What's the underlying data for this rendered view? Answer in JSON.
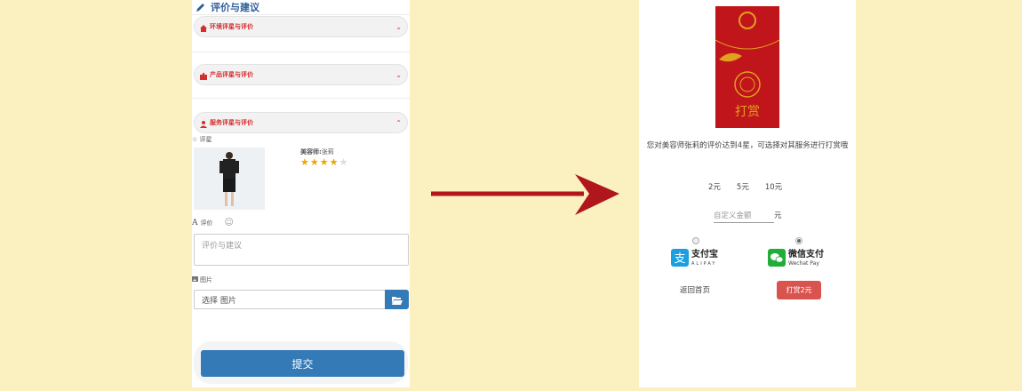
{
  "left": {
    "header_title": "评价与建议",
    "accordions": [
      {
        "label": "环境评星与评价",
        "icon": "home-icon"
      },
      {
        "label": "产品评星与评价",
        "icon": "briefcase-icon"
      },
      {
        "label": "服务评星与评价",
        "icon": "user-icon"
      }
    ],
    "rating_label": "☆ 评星",
    "beautician_prefix": "美容师:",
    "beautician_name": "张莉",
    "rating_stars": 4,
    "rating_max": 5,
    "comment_label": "评价",
    "comment_placeholder": "评价与建议",
    "image_label": "图片",
    "file_placeholder": "选择 图片",
    "submit_label": "提交",
    "colors": {
      "accent": "#337ab7",
      "red": "#d62d2d",
      "star": "#f0a500"
    }
  },
  "right": {
    "envelope_text": "打赏",
    "message": "您对美容师张莉的评价达到4星，可选择对其服务进行打赏哦",
    "amounts": [
      "2元",
      "5元",
      "10元"
    ],
    "custom_placeholder": "自定义金额",
    "unit": "元",
    "payments": [
      {
        "name": "支付宝",
        "sub": "ALIPAY",
        "icon": "alipay-icon",
        "selected": false
      },
      {
        "name": "微信支付",
        "sub": "Wechat Pay",
        "icon": "wechat-pay-icon",
        "selected": true
      }
    ],
    "back_label": "返回首页",
    "tip_button_label": "打赏2元",
    "colors": {
      "envelope": "#c0151a",
      "button": "#d9534f"
    }
  }
}
